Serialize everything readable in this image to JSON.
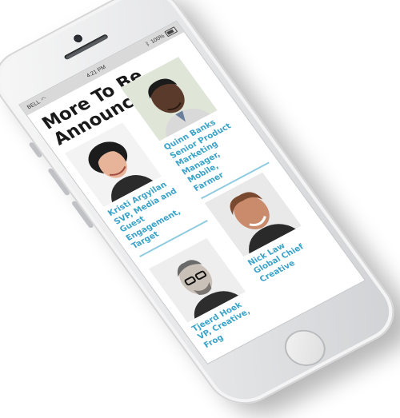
{
  "status": {
    "carrier": "BELL",
    "time": "4:21 PM",
    "battery": "100%"
  },
  "page": {
    "heading_line1": "More To Be",
    "heading_line2": "Announced..."
  },
  "speakers": [
    {
      "line1": "Kristi Argyilan",
      "line2": "SVP, Media and",
      "line3": "Guest",
      "line4": "Engagement,",
      "line5": "Target"
    },
    {
      "line1": "Quinn Banks",
      "line2": "Senior Product",
      "line3": "Marketing",
      "line4": "Manager,",
      "line5": "Mobile,",
      "line6": "Farmer"
    },
    {
      "line1": "Tjeerd Hoek",
      "line2": "VP, Creative,",
      "line3": "Frog"
    },
    {
      "line1": "Nick Law",
      "line2": "Global Chief",
      "line3": "Creative"
    }
  ],
  "colors": {
    "accent": "#3aa3c9",
    "divider": "#8fcbe0",
    "heading": "#1a1a1a"
  }
}
